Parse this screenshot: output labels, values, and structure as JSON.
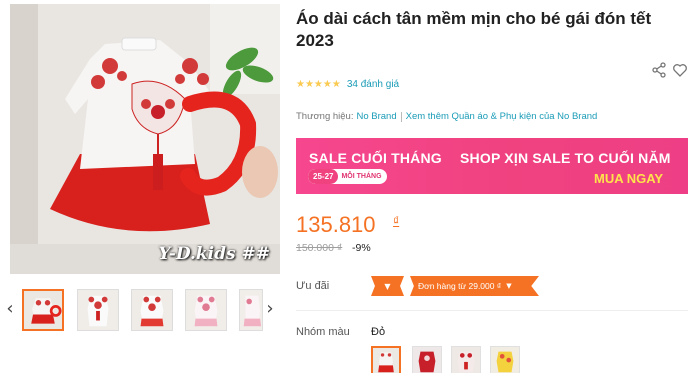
{
  "product": {
    "title": "Áo dài cách tân mềm mịn cho bé gái đón tết 2023",
    "stars": "★★★★★",
    "rating_count": "34 đánh giá",
    "brand_label": "Thương hiệu:",
    "brand_name": "No Brand",
    "brand_more": "Xem thêm Quần áo & Phụ kiện của No Brand",
    "image_watermark": "Y-D.kids ##",
    "icons": {
      "share": "share-icon",
      "favorite": "heart-icon",
      "prev": "chevron-left-icon",
      "next": "chevron-right-icon"
    }
  },
  "banner": {
    "left_text": "SALE CUỐI THÁNG",
    "dates": "25-27",
    "monthly": "MỖI THÁNG",
    "right_text": "SHOP XỊN SALE TO CUỐI NĂM",
    "cta": "MUA NGAY",
    "colors": {
      "background": "#f0427f",
      "cta": "#ffe34a"
    }
  },
  "pricing": {
    "price": "135.810",
    "currency": "₫",
    "original_price": "150.000 ₫",
    "discount": "-9%"
  },
  "promotions": {
    "label": "Ưu đãi",
    "arrow": "▼",
    "voucher_text": "Đơn hàng từ 29.000 ₫",
    "voucher_chevron": "▼"
  },
  "variants": {
    "label": "Nhóm màu",
    "selected": "Đỏ"
  },
  "theme": {
    "accent": "#f57224",
    "link": "#1a9cb7",
    "star": "#faca51"
  }
}
